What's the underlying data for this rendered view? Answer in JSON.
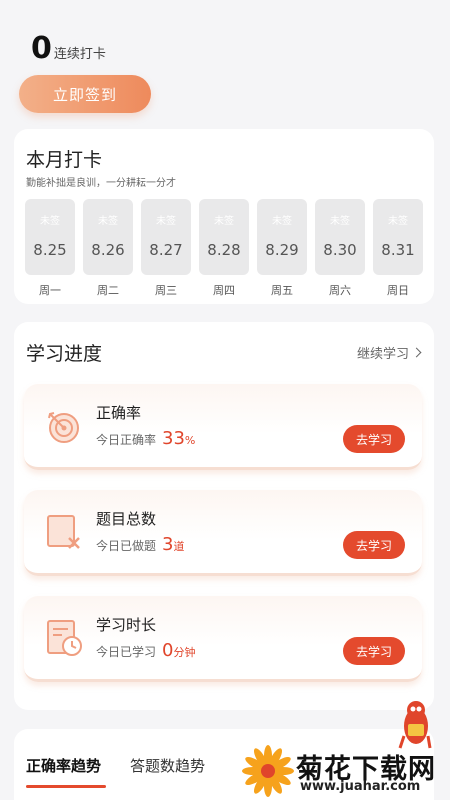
{
  "streak": {
    "count": "0",
    "label": "连续打卡"
  },
  "checkin_button": "立即签到",
  "month": {
    "title": "本月打卡",
    "subtitle": "勤能补拙是良训，一分耕耘一分才",
    "days": [
      {
        "status": "未签",
        "date": "8.25",
        "weekday": "周一"
      },
      {
        "status": "未签",
        "date": "8.26",
        "weekday": "周二"
      },
      {
        "status": "未签",
        "date": "8.27",
        "weekday": "周三"
      },
      {
        "status": "未签",
        "date": "8.28",
        "weekday": "周四"
      },
      {
        "status": "未签",
        "date": "8.29",
        "weekday": "周五"
      },
      {
        "status": "未签",
        "date": "8.30",
        "weekday": "周六"
      },
      {
        "status": "未签",
        "date": "8.31",
        "weekday": "周日"
      }
    ]
  },
  "progress": {
    "title": "学习进度",
    "continue_link": "继续学习",
    "items": [
      {
        "icon": "target-icon",
        "title": "正确率",
        "desc": "今日正确率",
        "value": "33",
        "unit": "%",
        "button": "去学习"
      },
      {
        "icon": "question-card-icon",
        "title": "题目总数",
        "desc": "今日已做题",
        "value": "3",
        "unit": "道",
        "button": "去学习"
      },
      {
        "icon": "clock-document-icon",
        "title": "学习时长",
        "desc": "今日已学习",
        "value": "0",
        "unit": "分钟",
        "button": "去学习"
      }
    ]
  },
  "trend_tabs": {
    "tab1": "正确率趋势",
    "tab2": "答题数趋势"
  },
  "watermark": {
    "title": "菊花下载网",
    "url": "www.juahar.com"
  },
  "colors": {
    "accent": "#e44a2d",
    "checkin_gradient_start": "#f3b089",
    "checkin_gradient_end": "#ee8a5c",
    "background": "#f5f5f7"
  }
}
